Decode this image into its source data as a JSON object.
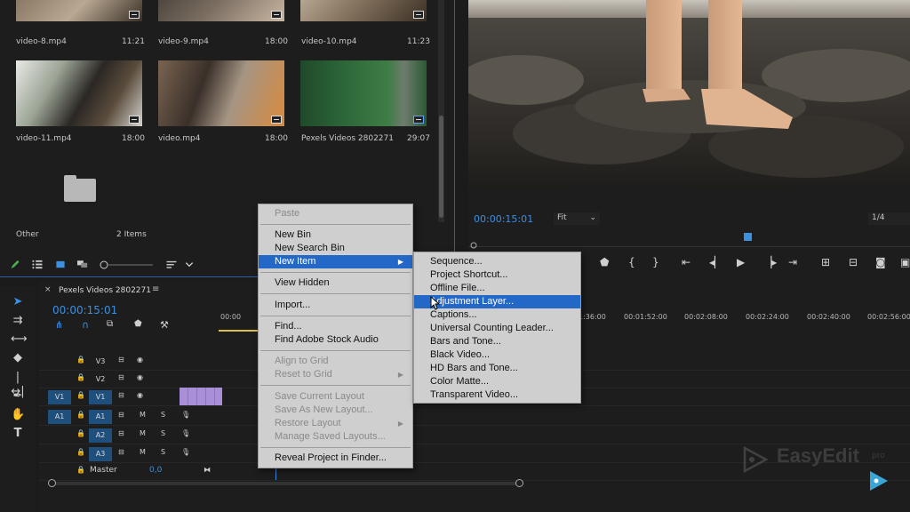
{
  "project": {
    "clips": [
      {
        "name": "video-8.mp4",
        "duration": "11:21"
      },
      {
        "name": "video-9.mp4",
        "duration": "18:00"
      },
      {
        "name": "video-10.mp4",
        "duration": "11:23"
      },
      {
        "name": "video-11.mp4",
        "duration": "18:00"
      },
      {
        "name": "video.mp4",
        "duration": "18:00"
      },
      {
        "name": "Pexels Videos 2802271",
        "duration": "29:07"
      }
    ],
    "folder": {
      "name": "Other",
      "items": "2 Items"
    }
  },
  "program": {
    "timecode": "00:00:15:01",
    "fit": "Fit",
    "resolution": "1/4"
  },
  "timeline": {
    "sequence_name": "Pexels Videos 2802271",
    "timecode": "00:00:15:01",
    "ruler": [
      "00:00",
      "1:36:00",
      "00:01:52:00",
      "00:02:08:00",
      "00:02:24:00",
      "00:02:40:00",
      "00:02:56:00"
    ],
    "tracks": [
      {
        "source": "",
        "name": "V3",
        "kind": "video"
      },
      {
        "source": "",
        "name": "V2",
        "kind": "video"
      },
      {
        "source": "V1",
        "name": "V1",
        "kind": "video"
      },
      {
        "source": "A1",
        "name": "A1",
        "kind": "audio"
      },
      {
        "source": "",
        "name": "A2",
        "kind": "audio"
      },
      {
        "source": "",
        "name": "A3",
        "kind": "audio"
      }
    ],
    "master": {
      "label": "Master",
      "value": "0,0"
    }
  },
  "context_menu": {
    "items": [
      {
        "label": "Paste",
        "state": "disabled"
      },
      {
        "label": "New Bin",
        "state": "normal"
      },
      {
        "label": "New Search Bin",
        "state": "normal"
      },
      {
        "label": "New Item",
        "state": "highlighted",
        "submenu": true
      },
      {
        "label": "View Hidden",
        "state": "normal"
      },
      {
        "label": "Import...",
        "state": "normal"
      },
      {
        "label": "Find...",
        "state": "normal"
      },
      {
        "label": "Find Adobe Stock Audio",
        "state": "normal"
      },
      {
        "label": "Align to Grid",
        "state": "disabled"
      },
      {
        "label": "Reset to Grid",
        "state": "disabled",
        "submenu": true
      },
      {
        "label": "Save Current Layout",
        "state": "disabled"
      },
      {
        "label": "Save As New Layout...",
        "state": "disabled"
      },
      {
        "label": "Restore Layout",
        "state": "disabled",
        "submenu": true
      },
      {
        "label": "Manage Saved Layouts...",
        "state": "disabled"
      },
      {
        "label": "Reveal Project in Finder...",
        "state": "normal"
      }
    ]
  },
  "submenu": {
    "items": [
      {
        "label": "Sequence...",
        "state": "normal"
      },
      {
        "label": "Project Shortcut...",
        "state": "normal"
      },
      {
        "label": "Offline File...",
        "state": "normal"
      },
      {
        "label": "Adjustment Layer...",
        "state": "highlighted"
      },
      {
        "label": "Captions...",
        "state": "normal"
      },
      {
        "label": "Universal Counting Leader...",
        "state": "normal"
      },
      {
        "label": "Bars and Tone...",
        "state": "normal"
      },
      {
        "label": "Black Video...",
        "state": "normal"
      },
      {
        "label": "HD Bars and Tone...",
        "state": "normal"
      },
      {
        "label": "Color Matte...",
        "state": "normal"
      },
      {
        "label": "Transparent Video...",
        "state": "normal"
      }
    ]
  },
  "watermark": {
    "brand": "EasyEdit",
    "suffix": "pro"
  },
  "colors": {
    "accent": "#3d8fe0",
    "menu_highlight": "#2468c7",
    "clip_purple": "#a88fd8"
  }
}
